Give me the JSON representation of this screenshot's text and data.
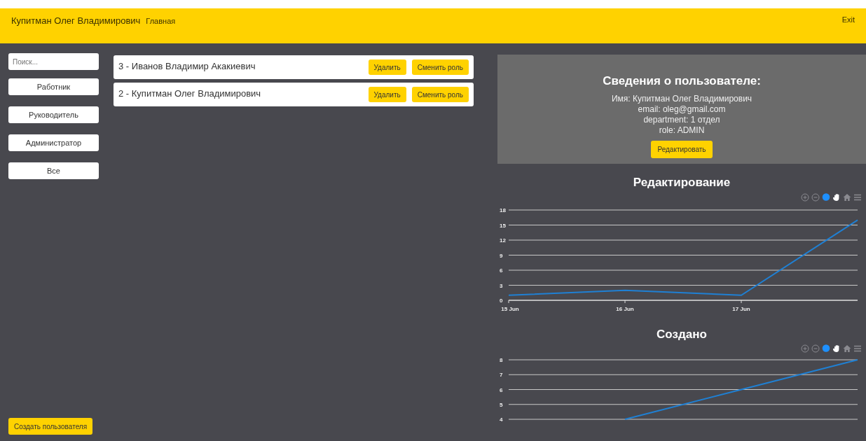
{
  "header": {
    "user_name": "Купитман Олег Владимирович",
    "nav_link": "Главная",
    "exit": "Exit"
  },
  "sidebar": {
    "search": {
      "placeholder": "Поиск..."
    },
    "filters": [
      "Работник",
      "Руководитель",
      "Администратор",
      "Все"
    ],
    "create_button": "Создать пользователя"
  },
  "users": [
    {
      "title": "3 - Иванов Владимир Акакиевич",
      "buttons": [
        "Удалить",
        "Сменить роль"
      ]
    },
    {
      "title": "2 - Купитман Олег Владимирович",
      "buttons": [
        "Удалить",
        "Сменить роль"
      ]
    }
  ],
  "user_info": {
    "heading": "Сведения о пользователе:",
    "lines": [
      "Имя: Купитман Олег Владимирович",
      "email: oleg@gmail.com",
      "department: 1 отдел",
      "role: ADMIN"
    ],
    "edit_button": "Редактировать"
  },
  "charts": [
    {
      "title": "Редактирование",
      "chart_data": {
        "type": "line",
        "grid": true,
        "categories": [
          "15 Jun",
          "16 Jun",
          "17 Jun",
          null
        ],
        "ylim": [
          0,
          18
        ],
        "yticks": [
          0,
          3,
          6,
          9,
          12,
          15,
          18
        ],
        "series": [
          {
            "color": "#1f80d4",
            "values": [
              1,
              2,
              1,
              16
            ]
          }
        ]
      }
    },
    {
      "title": "Создано",
      "chart_data": {
        "type": "line",
        "grid": true,
        "categories": [
          null,
          null,
          null,
          null
        ],
        "ylim": [
          4,
          8
        ],
        "yticks": [
          4,
          5,
          6,
          7,
          8
        ],
        "series": [
          {
            "color": "#1f80d4",
            "values": [
              null,
              4,
              6,
              8
            ]
          }
        ]
      }
    }
  ]
}
